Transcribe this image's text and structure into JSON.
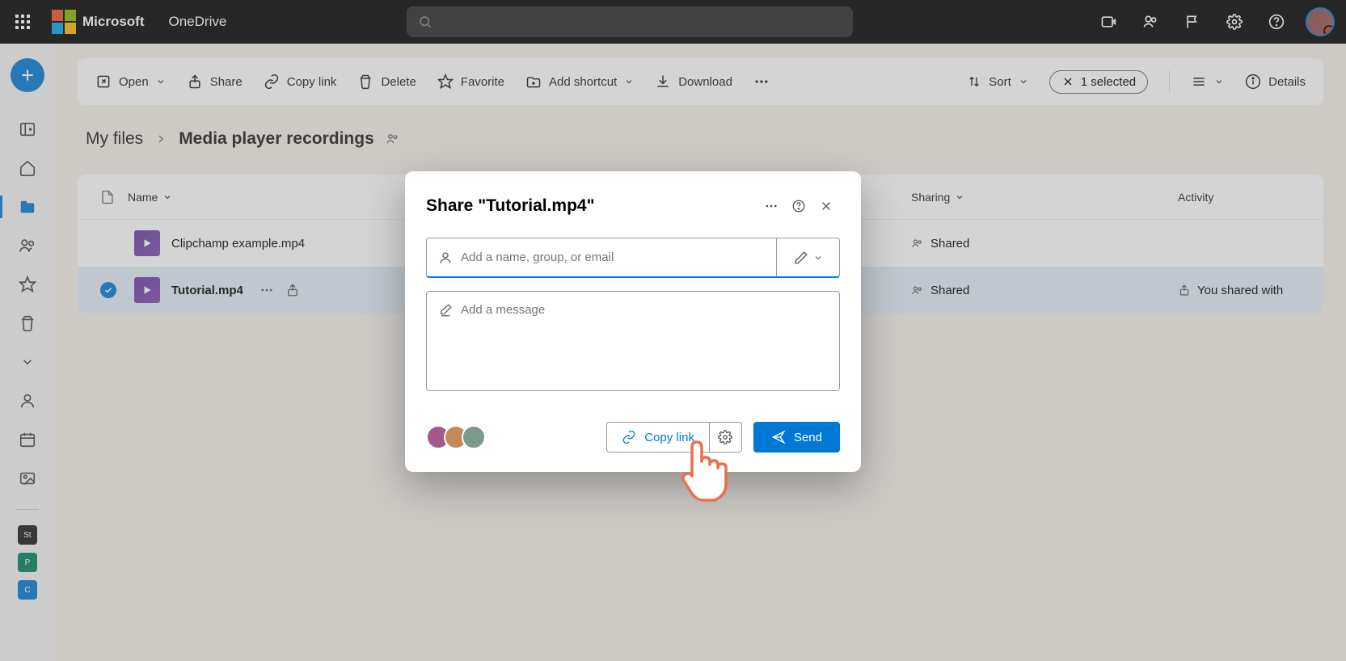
{
  "brand": {
    "company": "Microsoft",
    "app": "OneDrive"
  },
  "toolbar": {
    "open": "Open",
    "share": "Share",
    "copyLink": "Copy link",
    "delete": "Delete",
    "favorite": "Favorite",
    "addShortcut": "Add shortcut",
    "download": "Download",
    "sort": "Sort",
    "selected": "1 selected",
    "details": "Details"
  },
  "breadcrumb": {
    "root": "My files",
    "current": "Media player recordings"
  },
  "columns": {
    "name": "Name",
    "sharing": "Sharing",
    "activity": "Activity"
  },
  "sidebar": {
    "tiles": [
      {
        "label": "St",
        "color": "#1b1b1b"
      },
      {
        "label": "P",
        "color": "#00805f"
      },
      {
        "label": "C",
        "color": "#0078d4"
      }
    ]
  },
  "rows": [
    {
      "filename": "Clipchamp example.mp4",
      "sharing": "Shared",
      "activity": "",
      "selected": false
    },
    {
      "filename": "Tutorial.mp4",
      "sharing": "Shared",
      "activity": "You shared with",
      "selected": true
    }
  ],
  "dialog": {
    "title": "Share \"Tutorial.mp4\"",
    "recipientPlaceholder": "Add a name, group, or email",
    "messagePlaceholder": "Add a message",
    "copyLink": "Copy link",
    "send": "Send"
  }
}
